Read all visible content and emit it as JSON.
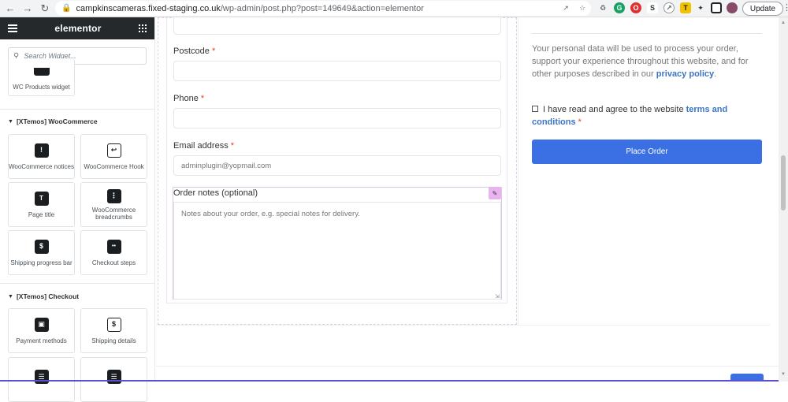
{
  "browser": {
    "url_host": "campkinscameras.fixed-staging.co.uk",
    "url_path": "/wp-admin/post.php?post=149649&action=elementor",
    "update_label": "Update",
    "colors": {
      "chrome_bg": "#f1f3f4"
    }
  },
  "panel": {
    "brand": "elementor",
    "search_placeholder": "Search Widget...",
    "widgets_top": [
      {
        "label": "WC Products widget"
      }
    ],
    "categories": [
      {
        "title": "[XTemos] WooCommerce",
        "widgets": [
          {
            "label": "WooCommerce notices",
            "icon": "alert-cart-icon"
          },
          {
            "label": "WooCommerce Hook",
            "icon": "hook-icon"
          },
          {
            "label": "Page title",
            "icon": "title-icon"
          },
          {
            "label": "WooCommerce breadcrumbs",
            "icon": "breadcrumb-icon"
          },
          {
            "label": "Shipping progress bar",
            "icon": "dollar-progress-icon"
          },
          {
            "label": "Checkout steps",
            "icon": "steps-cart-icon"
          }
        ]
      },
      {
        "title": "[XTemos] Checkout",
        "widgets": [
          {
            "label": "Payment methods",
            "icon": "wallet-icon"
          },
          {
            "label": "Shipping details",
            "icon": "shipping-doc-icon"
          }
        ]
      }
    ]
  },
  "form": {
    "postcode_label": "Postcode",
    "phone_label": "Phone",
    "email_label": "Email address",
    "email_value": "adminplugin@yopmail.com",
    "notes_label": "Order notes (optional)",
    "notes_placeholder": "Notes about your order, e.g. special notes for delivery.",
    "required_mark": "*"
  },
  "order": {
    "privacy_text": "Your personal data will be used to process your order, support your experience throughout this website, and for other purposes described in our ",
    "privacy_link": "privacy policy",
    "privacy_end": ".",
    "terms_text": "I have read and agree to the website ",
    "terms_link": "terms and conditions",
    "place_order_label": "Place Order",
    "colors": {
      "accent": "#3a70e4",
      "link": "#3b75c5",
      "required": "#e2401c"
    }
  }
}
